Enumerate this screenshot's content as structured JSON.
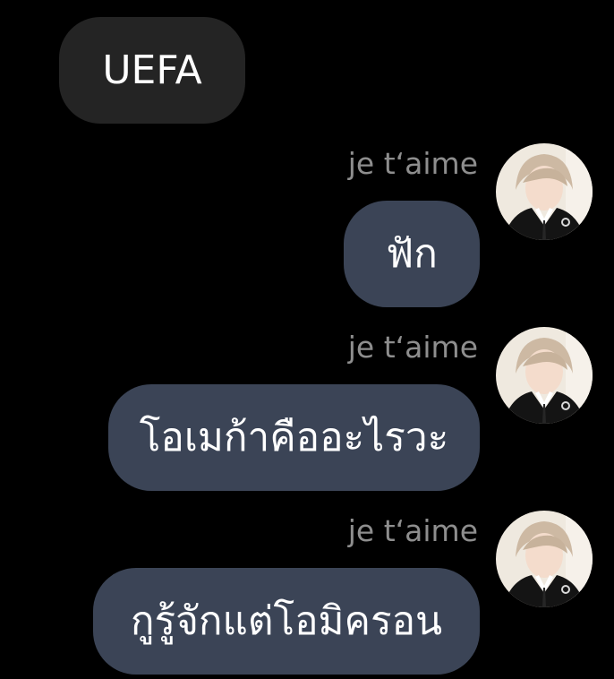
{
  "incoming_message": {
    "text": "UEFA"
  },
  "messages": [
    {
      "sender": "je t‘aime",
      "text": "ฟัก",
      "avatar_icon": "profile-photo-avatar"
    },
    {
      "sender": "je t‘aime",
      "text": "โอเมก้าคืออะไรวะ",
      "avatar_icon": "profile-photo-avatar"
    },
    {
      "sender": "je t‘aime",
      "text": "กูรู้จักแต่โอมิครอน",
      "avatar_icon": "profile-photo-avatar"
    }
  ],
  "colors": {
    "background": "#000000",
    "incoming_bubble": "#242424",
    "outgoing_bubble": "#3b4456",
    "sender_text": "#8e8e8e",
    "message_text": "#ffffff"
  }
}
